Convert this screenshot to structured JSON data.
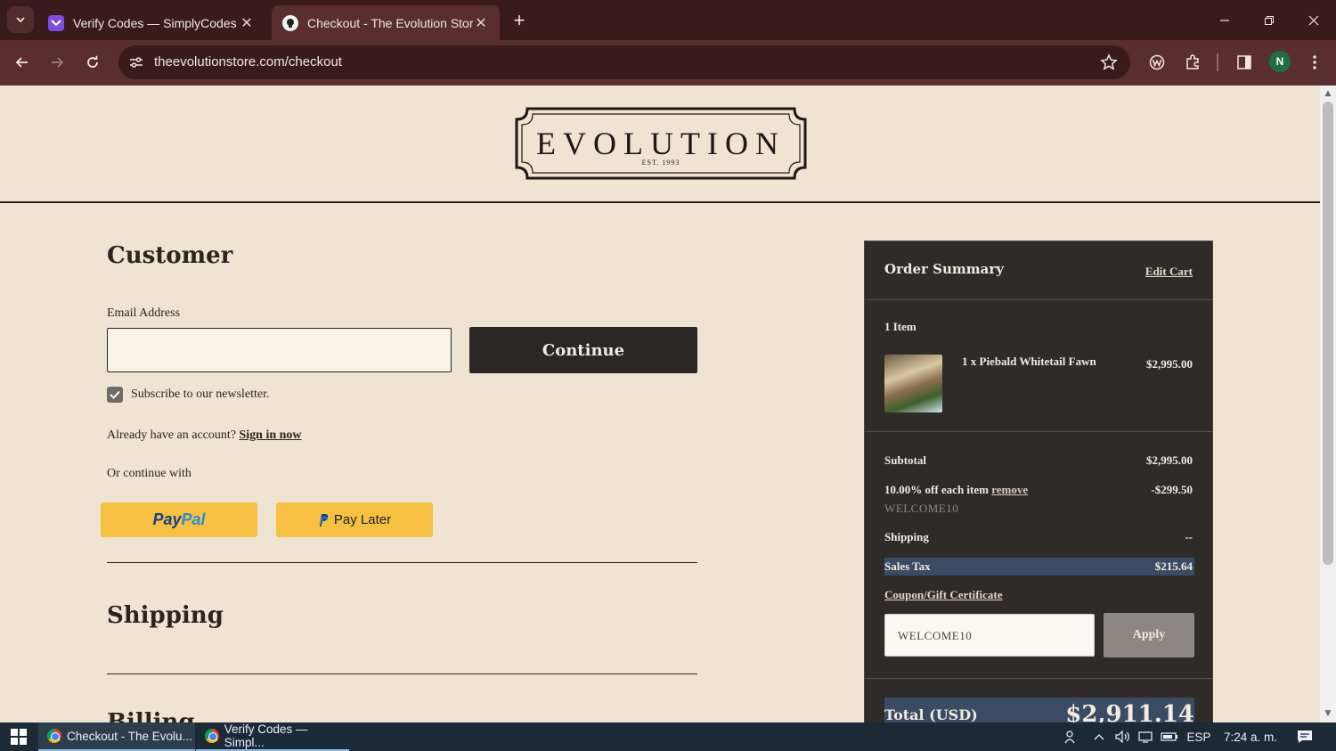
{
  "browser": {
    "tabs": [
      {
        "title": "Verify Codes — SimplyCodes"
      },
      {
        "title": "Checkout - The Evolution Store"
      }
    ],
    "url": "theevolutionstore.com/checkout",
    "profile_initial": "N"
  },
  "store": {
    "logo_text": "EVOLUTION",
    "logo_sub": "EST. 1993"
  },
  "customer": {
    "heading": "Customer",
    "email_label": "Email Address",
    "email_value": "",
    "continue_label": "Continue",
    "newsletter_label": "Subscribe to our newsletter.",
    "newsletter_checked": true,
    "account_prompt": "Already have an account?",
    "sign_in_label": "Sign in now",
    "or_continue": "Or continue with",
    "paypal_label_a": "Pay",
    "paypal_label_b": "Pal",
    "paylater_label": "Pay Later"
  },
  "shipping": {
    "heading": "Shipping"
  },
  "billing": {
    "heading": "Billing"
  },
  "summary": {
    "title": "Order Summary",
    "edit_cart": "Edit Cart",
    "item_count": "1 Item",
    "item_name": "1 x Piebald Whitetail Fawn",
    "item_price": "$2,995.00",
    "subtotal_label": "Subtotal",
    "subtotal_value": "$2,995.00",
    "discount_label": "10.00% off each item",
    "discount_remove": "remove",
    "discount_value": "-$299.50",
    "discount_code": "WELCOME10",
    "shipping_label": "Shipping",
    "shipping_value": "--",
    "tax_label": "Sales Tax",
    "tax_value": "$215.64",
    "coupon_link": "Coupon/Gift Certificate",
    "coupon_value": "WELCOME10",
    "apply_label": "Apply",
    "total_label": "Total (USD)",
    "total_value": "$2,911.14"
  },
  "taskbar": {
    "tasks": [
      {
        "label": "Checkout - The Evolu..."
      },
      {
        "label": "Verify Codes — Simpl..."
      }
    ],
    "lang": "ESP",
    "time": "7:24 a. m."
  },
  "colors": {
    "page_bg": "#efe4d2",
    "summary_bg": "#2f2b28",
    "highlight": "#3a4b63",
    "paypal_yellow": "#f6c142",
    "browser_frame": "#3a1b1d"
  }
}
